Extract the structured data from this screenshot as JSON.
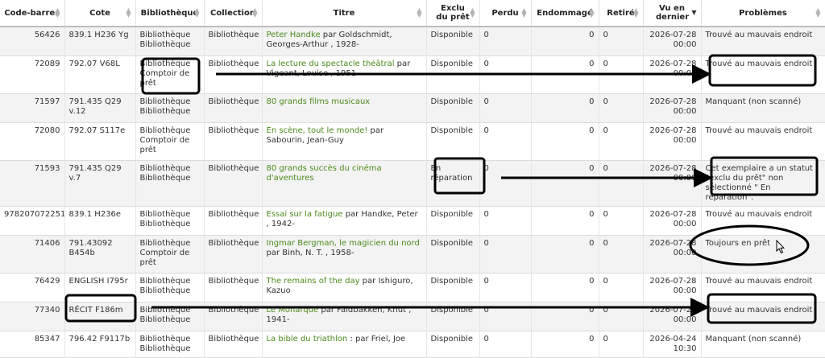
{
  "columns": [
    "Code-barres",
    "Cote",
    "Bibliothèque",
    "Collection",
    "Titre",
    "Exclu du prêt",
    "Perdu",
    "Endommagé",
    "Retiré",
    "Vu en dernier",
    "Problèmes"
  ],
  "rows": [
    {
      "barcode": "56426",
      "cote": "839.1 H236 Yg",
      "library": "Bibliothèque Bibliothèque",
      "collection": "Bibliothèque",
      "title": "Peter Handke",
      "author": " par Goldschmidt, Georges-Arthur , 1928-",
      "exclu": "Disponible",
      "perdu": "0",
      "endommage": "0",
      "retire": "0",
      "vu": "2026-07-28 00:00",
      "probleme": "Trouvé au mauvais endroit"
    },
    {
      "barcode": "72089",
      "cote": "792.07 V68L",
      "library": "Bibliothèque Comptoir de prêt",
      "collection": "Bibliothèque",
      "title": "La lecture du spectacle théâtral",
      "author": " par Vigeant, Louise , 1951-",
      "exclu": "Disponible",
      "perdu": "0",
      "endommage": "0",
      "retire": "0",
      "vu": "2026-07-28 00:00",
      "probleme": "Trouvé au mauvais endroit"
    },
    {
      "barcode": "71597",
      "cote": "791.435 Q29 v.12",
      "library": "Bibliothèque Bibliothèque",
      "collection": "Bibliothèque",
      "title": "80 grands films musicaux",
      "author": "",
      "exclu": "Disponible",
      "perdu": "0",
      "endommage": "0",
      "retire": "0",
      "vu": "2026-07-28 00:00",
      "probleme": "Manquant (non scanné)"
    },
    {
      "barcode": "72080",
      "cote": "792.07 S117e",
      "library": "Bibliothèque Comptoir de prêt",
      "collection": "Bibliothèque",
      "title": "En scène, tout le monde!",
      "author": " par Sabourin, Jean-Guy",
      "exclu": "Disponible",
      "perdu": "0",
      "endommage": "0",
      "retire": "0",
      "vu": "2026-07-28 00:00",
      "probleme": "Trouvé au mauvais endroit"
    },
    {
      "barcode": "71593",
      "cote": "791.435 Q29 v.7",
      "library": "Bibliothèque Bibliothèque",
      "collection": "Bibliothèque",
      "title": "80 grands succès du cinéma d'aventures",
      "author": "",
      "exclu": "En réparation",
      "perdu": "0",
      "endommage": "0",
      "retire": "0",
      "vu": "2026-07-28 00:00",
      "probleme": "Cet exemplaire a un statut \"exclu du prêt\" non sélectionné \" En réparation\"."
    },
    {
      "barcode": "9782070722518",
      "cote": "839.1 H236e",
      "library": "Bibliothèque Bibliothèque",
      "collection": "Bibliothèque",
      "title": "Essai sur la fatigue",
      "author": " par Handke, Peter , 1942-",
      "exclu": "Disponible",
      "perdu": "0",
      "endommage": "0",
      "retire": "0",
      "vu": "2026-07-28 00:00",
      "probleme": "Trouvé au mauvais endroit"
    },
    {
      "barcode": "71406",
      "cote": "791.43092 B454b",
      "library": "Bibliothèque Comptoir de prêt",
      "collection": "Bibliothèque",
      "title": "Ingmar Bergman, le magicien du nord",
      "author": " par Binh, N. T. , 1958-",
      "exclu": "Disponible",
      "perdu": "0",
      "endommage": "0",
      "retire": "0",
      "vu": "2026-07-28 00:00",
      "probleme": "Toujours en prêt"
    },
    {
      "barcode": "76429",
      "cote": "ENGLISH I795r",
      "library": "Bibliothèque Bibliothèque",
      "collection": "Bibliothèque",
      "title": "The remains of the day",
      "author": " par Ishiguro, Kazuo",
      "exclu": "Disponible",
      "perdu": "0",
      "endommage": "0",
      "retire": "0",
      "vu": "2026-07-28 00:00",
      "probleme": "Trouvé au mauvais endroit"
    },
    {
      "barcode": "77340",
      "cote": "RÉCIT F186m",
      "library": "Bibliothèque Bibliothèque",
      "collection": "Bibliothèque",
      "title": "Le Monarque",
      "author": " par Faldbakken, Knut , 1941-",
      "exclu": "Disponible",
      "perdu": "0",
      "endommage": "0",
      "retire": "0",
      "vu": "2026-07-28 00:00",
      "probleme": "Trouvé au mauvais endroit"
    },
    {
      "barcode": "85347",
      "cote": "796.42 F9117b",
      "library": "Bibliothèque Bibliothèque",
      "collection": "Bibliothèque",
      "title": "La bible du triathlon",
      "author": " : par Friel, Joe",
      "exclu": "Disponible",
      "perdu": "0",
      "endommage": "0",
      "retire": "0",
      "vu": "2026-04-24 10:30",
      "probleme": "Manquant (non scanné)"
    }
  ]
}
